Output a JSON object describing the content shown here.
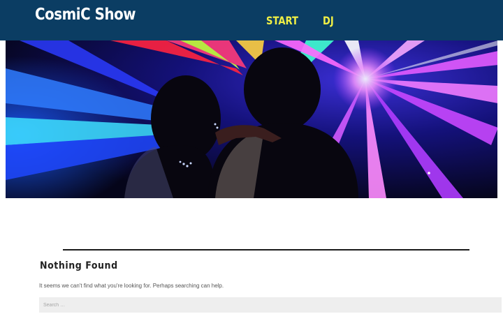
{
  "header": {
    "site_title": "CosmiC Show",
    "nav": [
      "START",
      "DJ"
    ]
  },
  "content": {
    "title": "Nothing Found",
    "message": "It seems we can't find what you're looking for. Perhaps searching can help.",
    "search_placeholder": "Search …"
  },
  "colors": {
    "header_bg": "#0b3d63",
    "nav_text": "#f0ef45",
    "search_bg": "#eeeeee"
  }
}
